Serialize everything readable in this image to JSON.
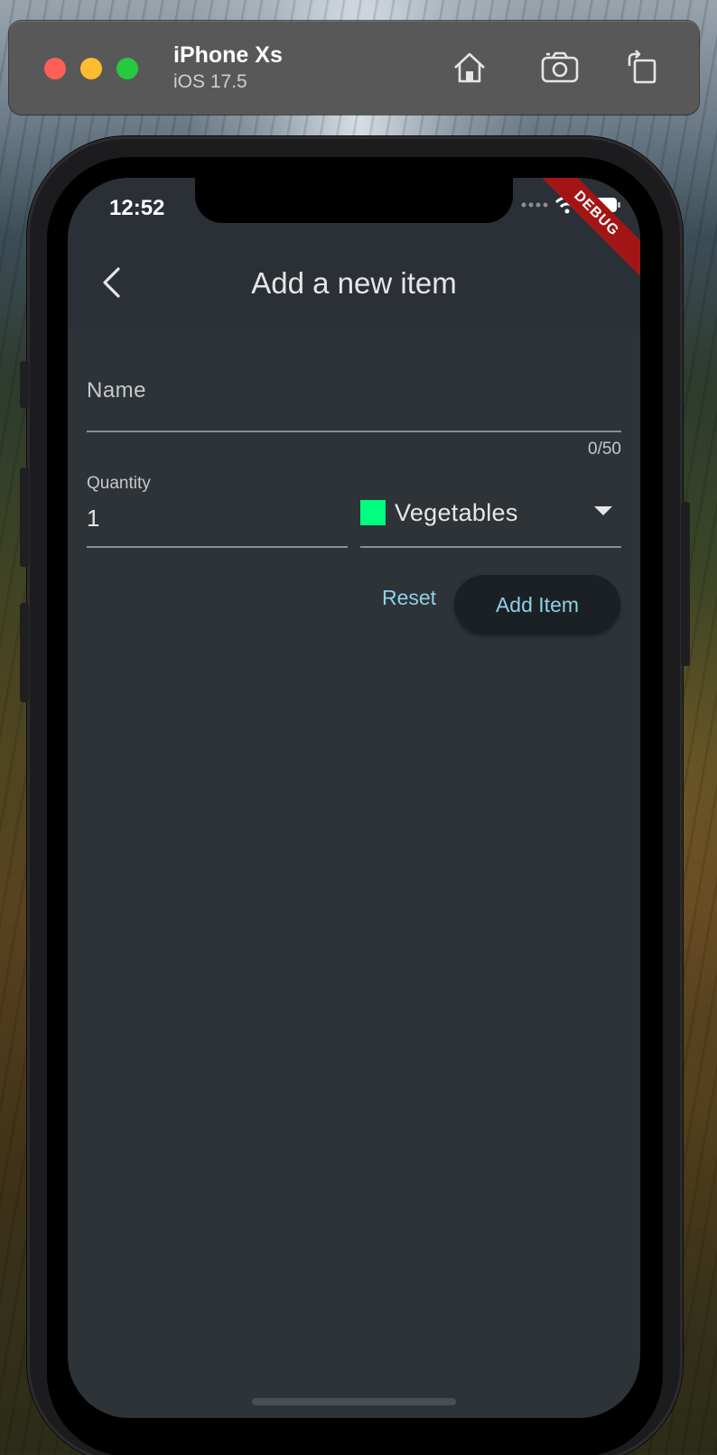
{
  "simulator": {
    "device_name": "iPhone Xs",
    "os_version": "iOS 17.5",
    "icons": [
      "home-icon",
      "screenshot-icon",
      "rotate-icon"
    ]
  },
  "status_bar": {
    "time": "12:52",
    "icons": [
      "signal-dots-icon",
      "wifi-icon",
      "battery-icon"
    ]
  },
  "debug_banner": "DEBUG",
  "appbar": {
    "title": "Add a new item",
    "back_icon": "back-arrow-icon"
  },
  "form": {
    "name": {
      "label": "Name",
      "value": "",
      "counter": "0/50"
    },
    "quantity": {
      "label": "Quantity",
      "value": "1"
    },
    "category": {
      "selected": "Vegetables",
      "swatch_color": "#00ff80"
    },
    "buttons": {
      "reset": "Reset",
      "add": "Add Item"
    }
  },
  "colors": {
    "accent": "#8fd0e8",
    "background": "#2d3337",
    "appbar": "#2a3036",
    "debug": "#a31515"
  }
}
